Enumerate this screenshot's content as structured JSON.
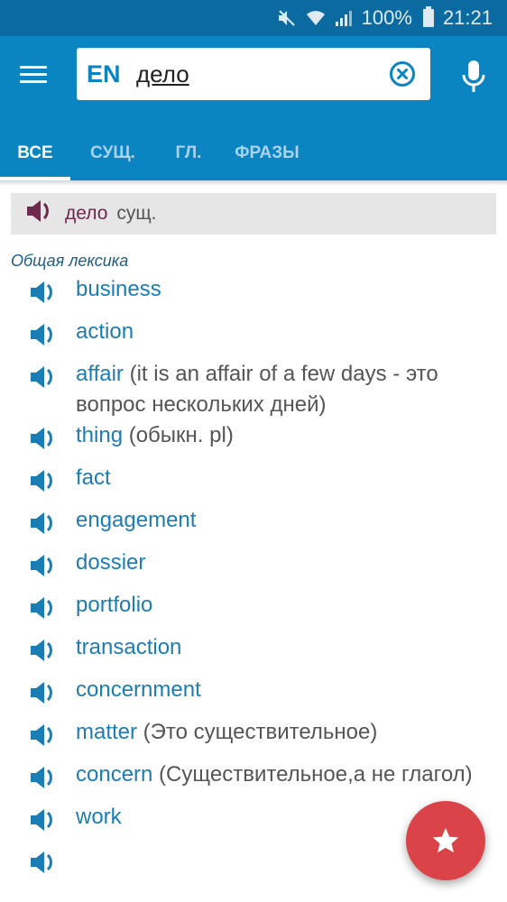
{
  "status_bar": {
    "icons": [
      "mute-icon",
      "wifi-icon",
      "signal-icon",
      "battery-icon"
    ],
    "battery": "100%",
    "time": "21:21"
  },
  "app_bar": {
    "menu_icon": "hamburger-menu-icon",
    "language": "EN",
    "search_value": "дело",
    "clear_icon": "clear-circle-icon",
    "mic_icon": "microphone-icon"
  },
  "tabs": [
    {
      "label": "ВСЕ",
      "active": true
    },
    {
      "label": "СУЩ.",
      "active": false
    },
    {
      "label": "ГЛ.",
      "active": false
    },
    {
      "label": "ФРАЗЫ",
      "active": false
    }
  ],
  "headword": {
    "word": "дело",
    "pos": "сущ."
  },
  "category": "Общая лексика",
  "translations": [
    {
      "word": "business",
      "note": ""
    },
    {
      "word": "action",
      "note": ""
    },
    {
      "word": "affair",
      "note": "(it is an affair of a few days - это вопрос нескольких дней)"
    },
    {
      "word": "thing",
      "note": "(обыкн. pl)"
    },
    {
      "word": "fact",
      "note": ""
    },
    {
      "word": "engagement",
      "note": ""
    },
    {
      "word": "dossier",
      "note": ""
    },
    {
      "word": "portfolio",
      "note": ""
    },
    {
      "word": "transaction",
      "note": ""
    },
    {
      "word": "concernment",
      "note": ""
    },
    {
      "word": "matter",
      "note": "(Это существительное)"
    },
    {
      "word": "concern",
      "note": "(Существительное,а не глагол)"
    },
    {
      "word": "work",
      "note": ""
    }
  ],
  "fab": {
    "icon": "star-icon"
  },
  "colors": {
    "status_bar": "#0b6aa0",
    "app_bar": "#0a85c2",
    "word": "#1a7db4",
    "headword": "#6d2a4c",
    "category": "#1d5d86",
    "fab": "#da4448"
  }
}
